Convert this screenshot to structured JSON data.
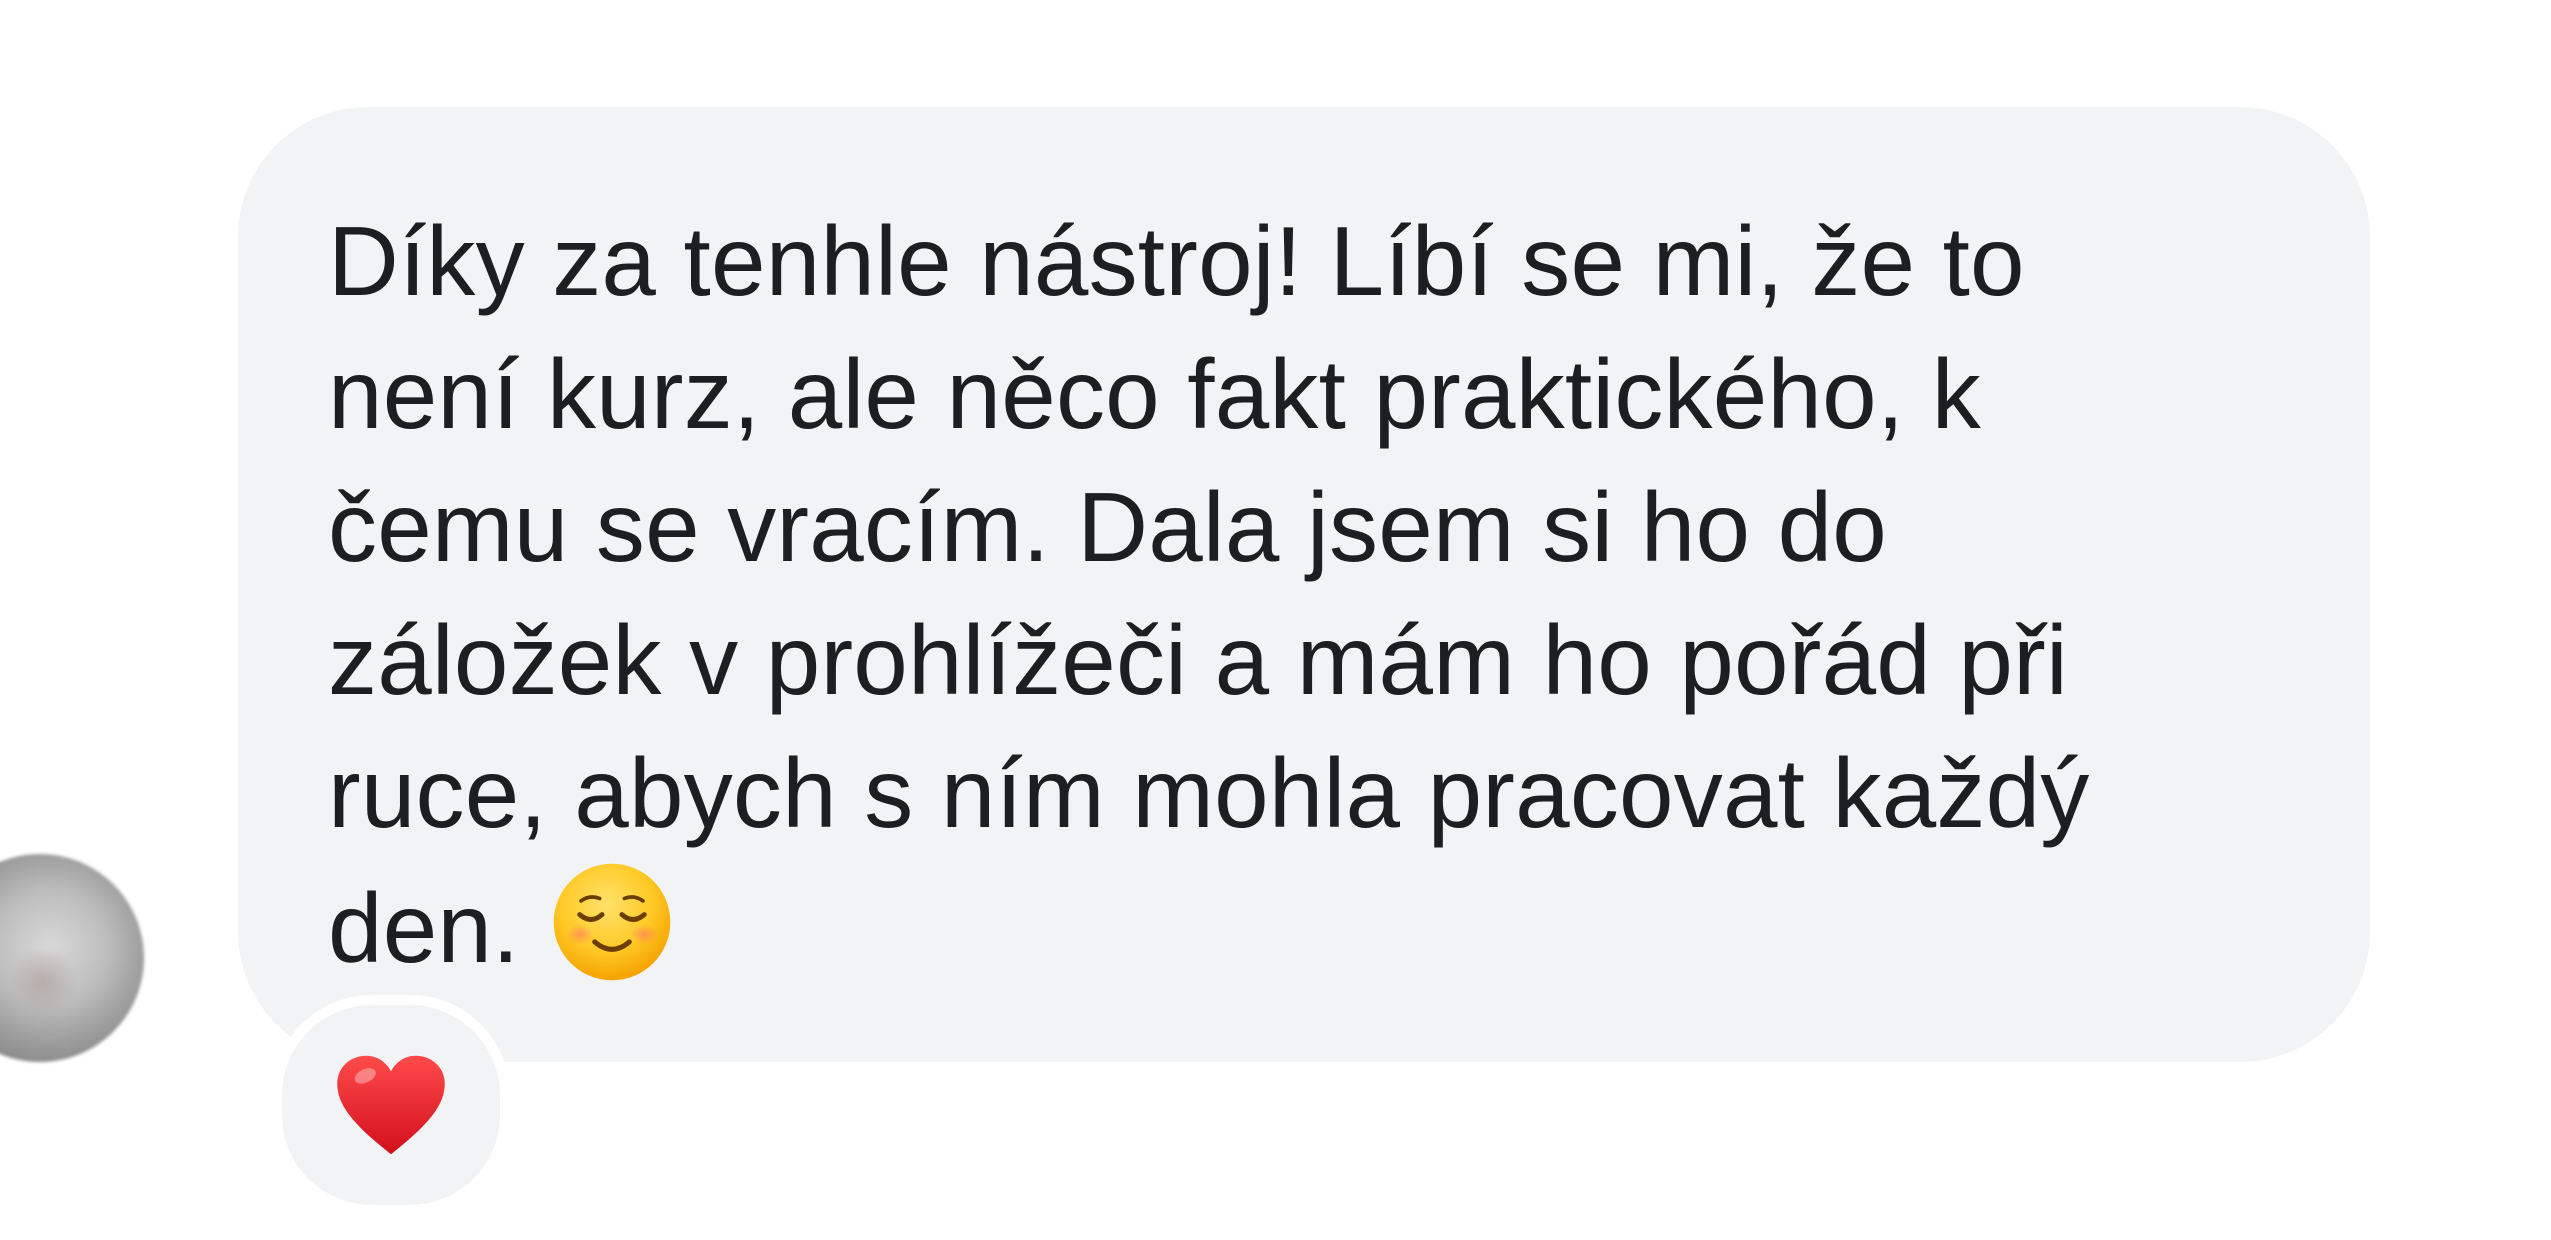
{
  "message": {
    "text": "Díky za tenhle nástroj! Líbí se mi, že to\nnení kurz, ale něco fakt praktického, k\nčemu se vracím. Dala jsem si ho do\nzáložek v prohlížeči a mám ho pořád při\nruce, abych s ním mohla pracovat každý\nden.",
    "emoji": "smiling-face-icon"
  },
  "reaction": {
    "emoji": "red-heart-icon",
    "color": "#e0202a"
  },
  "colors": {
    "bubble": "#f2f3f5",
    "text": "#1c1e21",
    "background": "#ffffff"
  }
}
